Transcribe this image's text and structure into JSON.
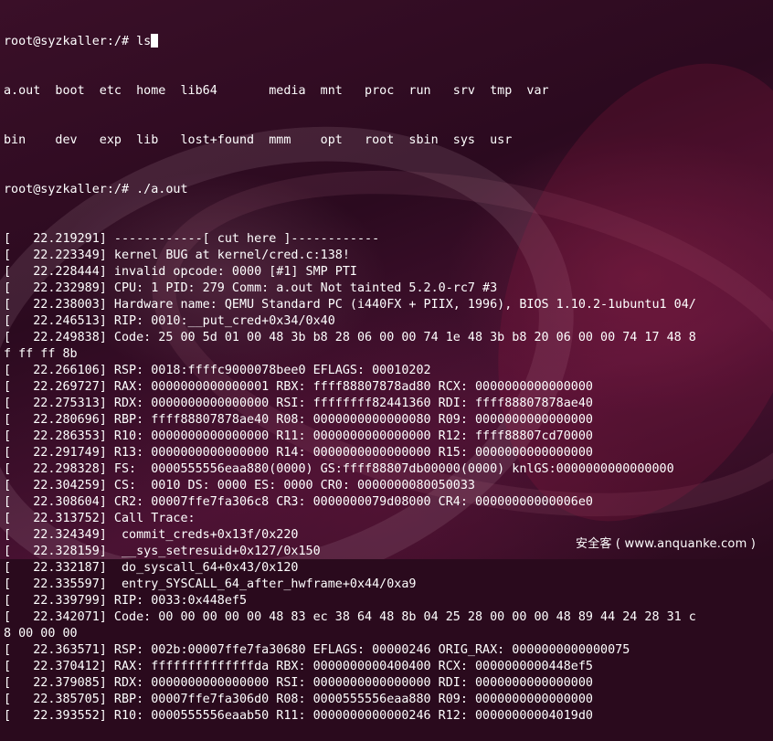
{
  "terminal": {
    "prompt_1": "root@syzkaller:/# ls",
    "ls_row_1": "a.out  boot  etc  home  lib64       media  mnt   proc  run   srv  tmp  var",
    "ls_row_2": "bin    dev   exp  lib   lost+found  mmm    opt   root  sbin  sys  usr",
    "prompt_2": "root@syzkaller:/# ./a.out",
    "output": [
      "[   22.219291] ------------[ cut here ]------------",
      "[   22.223349] kernel BUG at kernel/cred.c:138!",
      "[   22.228444] invalid opcode: 0000 [#1] SMP PTI",
      "[   22.232989] CPU: 1 PID: 279 Comm: a.out Not tainted 5.2.0-rc7 #3",
      "[   22.238003] Hardware name: QEMU Standard PC (i440FX + PIIX, 1996), BIOS 1.10.2-1ubuntu1 04/",
      "[   22.246513] RIP: 0010:__put_cred+0x34/0x40",
      "[   22.249838] Code: 25 00 5d 01 00 48 3b b8 28 06 00 00 74 1e 48 3b b8 20 06 00 00 74 17 48 8",
      "f ff ff 8b",
      "[   22.266106] RSP: 0018:ffffc9000078bee0 EFLAGS: 00010202",
      "[   22.269727] RAX: 0000000000000001 RBX: ffff88807878ad80 RCX: 0000000000000000",
      "[   22.275313] RDX: 0000000000000000 RSI: ffffffff82441360 RDI: ffff88807878ae40",
      "[   22.280696] RBP: ffff88807878ae40 R08: 0000000000000080 R09: 0000000000000000",
      "[   22.286353] R10: 0000000000000000 R11: 0000000000000000 R12: ffff88807cd70000",
      "[   22.291749] R13: 0000000000000000 R14: 0000000000000000 R15: 0000000000000000",
      "[   22.298328] FS:  0000555556eaa880(0000) GS:ffff88807db00000(0000) knlGS:0000000000000000",
      "[   22.304259] CS:  0010 DS: 0000 ES: 0000 CR0: 0000000080050033",
      "[   22.308604] CR2: 00007ffe7fa306c8 CR3: 0000000079d08000 CR4: 00000000000006e0",
      "[   22.313752] Call Trace:",
      "[   22.324349]  commit_creds+0x13f/0x220",
      "[   22.328159]  __sys_setresuid+0x127/0x150",
      "[   22.332187]  do_syscall_64+0x43/0x120",
      "[   22.335597]  entry_SYSCALL_64_after_hwframe+0x44/0xa9",
      "[   22.339799] RIP: 0033:0x448ef5",
      "[   22.342071] Code: 00 00 00 00 00 48 83 ec 38 64 48 8b 04 25 28 00 00 00 48 89 44 24 28 31 c",
      "8 00 00 00",
      "[   22.363571] RSP: 002b:00007ffe7fa30680 EFLAGS: 00000246 ORIG_RAX: 0000000000000075",
      "[   22.370412] RAX: ffffffffffffffda RBX: 0000000000400400 RCX: 0000000000448ef5",
      "[   22.379085] RDX: 0000000000000000 RSI: 0000000000000000 RDI: 0000000000000000",
      "[   22.385705] RBP: 00007ffe7fa306d0 R08: 0000555556eaa880 R09: 0000000000000000",
      "[   22.393552] R10: 0000555556eaab50 R11: 0000000000000246 R12: 00000000004019d0"
    ]
  },
  "watermark": "安全客 ( www.anquanke.com )"
}
